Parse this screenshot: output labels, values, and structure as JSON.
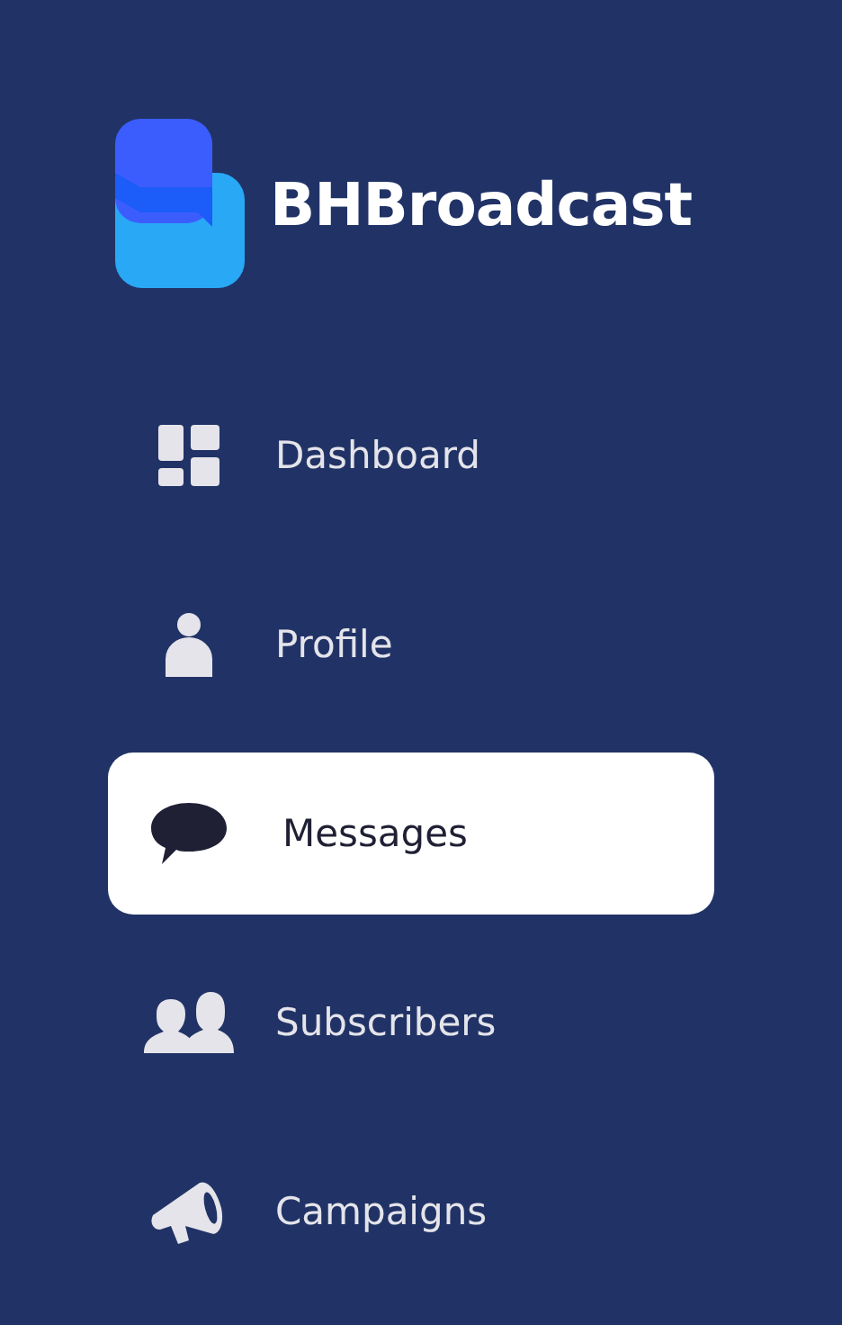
{
  "app": {
    "name": "BHBroadcast"
  },
  "nav": [
    {
      "label": "Dashboard",
      "selected": false
    },
    {
      "label": "Profile",
      "selected": false
    },
    {
      "label": "Messages",
      "selected": true
    },
    {
      "label": "Subscribers",
      "selected": false
    },
    {
      "label": "Campaigns",
      "selected": false
    }
  ]
}
